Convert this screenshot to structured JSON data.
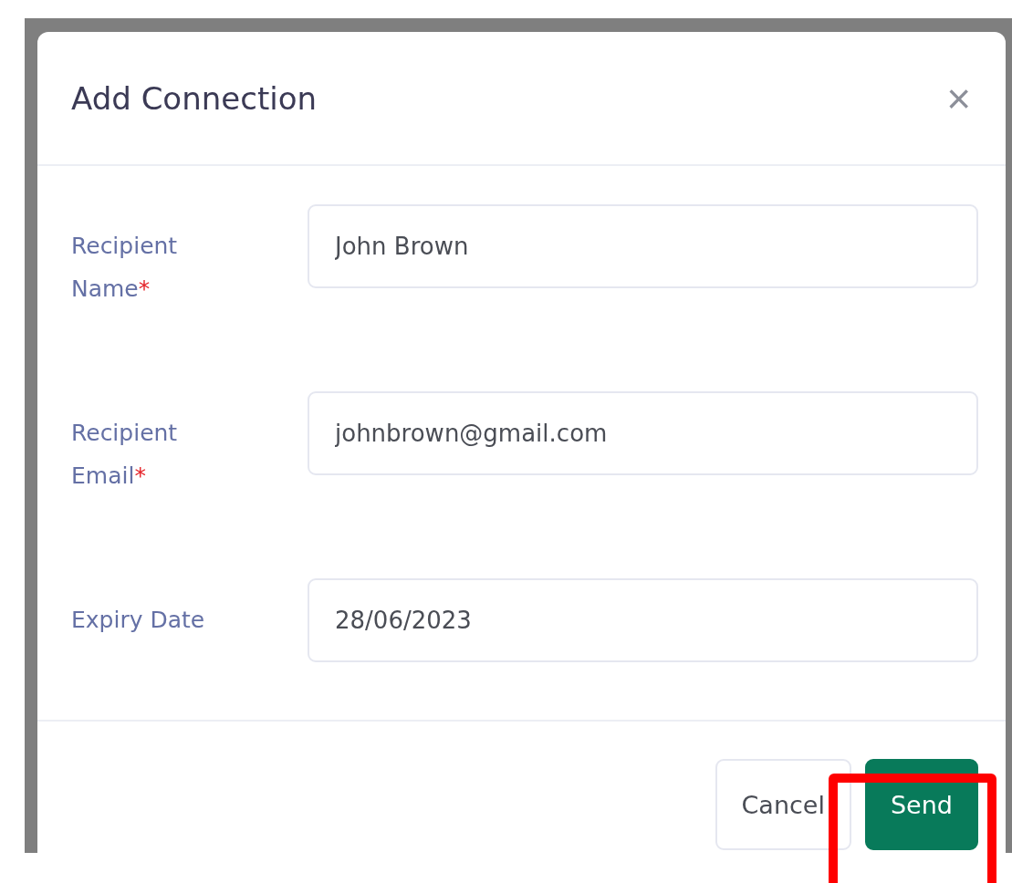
{
  "dialog": {
    "title": "Add Connection",
    "close": "×"
  },
  "fields": [
    {
      "label": "Recipient Name",
      "marker": "*",
      "value": "John Brown"
    },
    {
      "label": "Recipient Email",
      "marker": "*",
      "value": "johnbrown@gmail.com"
    },
    {
      "label": "Expiry Date",
      "value": "28/06/2023"
    }
  ],
  "buttons": [
    {
      "label": "Cancel",
      "kind": "secondary",
      "highlighted": false
    },
    {
      "label": "Send",
      "kind": "primary",
      "highlighted": true
    }
  ]
}
